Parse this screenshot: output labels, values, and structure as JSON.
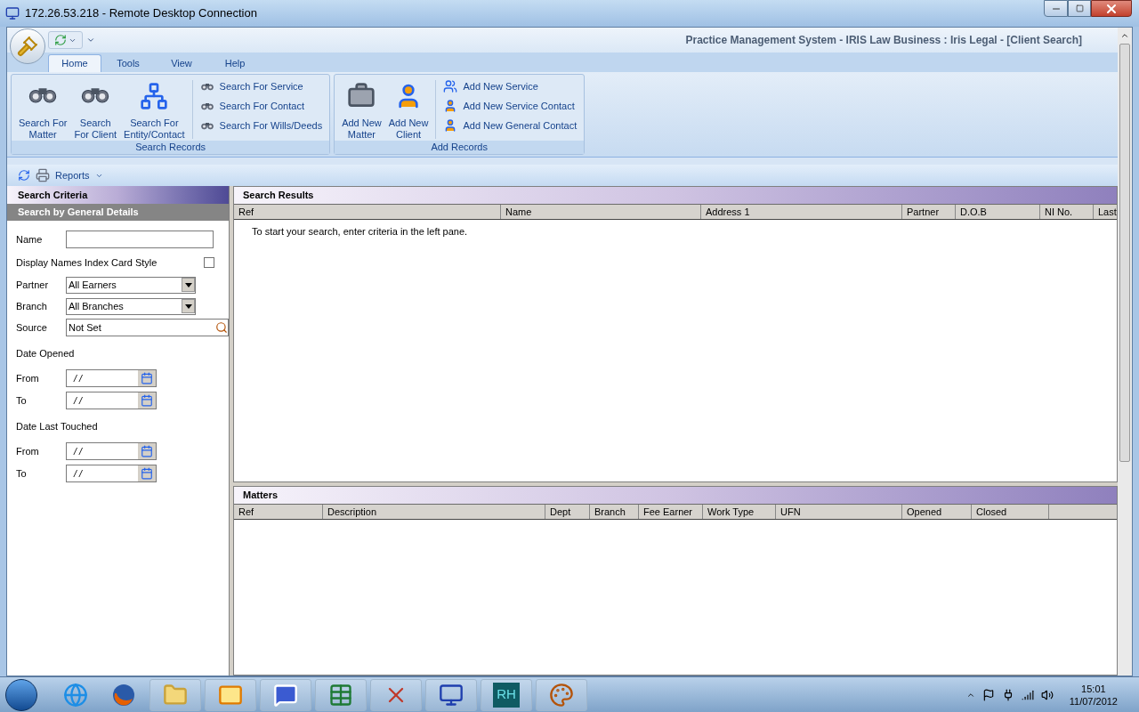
{
  "window": {
    "title": "172.26.53.218 - Remote Desktop Connection"
  },
  "app_title": "Practice Management System - IRIS Law Business : Iris Legal - [Client Search]",
  "ribbon": {
    "tabs": [
      {
        "label": "Home",
        "selected": true
      },
      {
        "label": "Tools",
        "selected": false
      },
      {
        "label": "View",
        "selected": false
      },
      {
        "label": "Help",
        "selected": false
      }
    ],
    "groups": [
      {
        "label": "Search Records",
        "large_buttons": [
          {
            "label": "Search For\nMatter",
            "kind": "binoculars"
          },
          {
            "label": "Search\nFor Client",
            "kind": "binoculars"
          },
          {
            "label": "Search For\nEntity/Contact",
            "kind": "network"
          }
        ],
        "small_buttons": [
          {
            "label": "Search For Service",
            "kind": "binoculars"
          },
          {
            "label": "Search For Contact",
            "kind": "binoculars"
          },
          {
            "label": "Search For Wills/Deeds",
            "kind": "binoculars"
          }
        ]
      },
      {
        "label": "Add Records",
        "large_buttons": [
          {
            "label": "Add New\nMatter",
            "kind": "briefcase"
          },
          {
            "label": "Add New\nClient",
            "kind": "person"
          }
        ],
        "small_buttons": [
          {
            "label": "Add New Service",
            "kind": "people"
          },
          {
            "label": "Add New Service Contact",
            "kind": "person"
          },
          {
            "label": "Add New General Contact",
            "kind": "person"
          }
        ]
      }
    ]
  },
  "toolbar": {
    "reports": "Reports"
  },
  "criteria": {
    "title": "Search Criteria",
    "subtitle": "Search by General Details",
    "fields": [
      {
        "kind": "text",
        "label": "Name"
      },
      {
        "kind": "checkbox",
        "label": "Display Names Index Card Style",
        "checked": false
      },
      {
        "kind": "select",
        "label": "Partner",
        "value": "All Earners"
      },
      {
        "kind": "select",
        "label": "Branch",
        "value": "All Branches"
      },
      {
        "kind": "lookup",
        "label": "Source",
        "value": "Not Set"
      },
      {
        "kind": "heading",
        "label": "Date Opened"
      },
      {
        "kind": "date",
        "label": "From",
        "value": "/ /"
      },
      {
        "kind": "date",
        "label": "To",
        "value": "/ /"
      },
      {
        "kind": "heading",
        "label": "Date Last Touched"
      },
      {
        "kind": "date",
        "label": "From",
        "value": "/ /"
      },
      {
        "kind": "date",
        "label": "To",
        "value": "/ /"
      }
    ]
  },
  "results": {
    "title": "Search Results",
    "columns": [
      "Ref",
      "Name",
      "Address 1",
      "Partner",
      "D.O.B",
      "NI No.",
      "Last"
    ],
    "message": "To start your search, enter criteria in the left pane."
  },
  "matters": {
    "title": "Matters",
    "columns": [
      "Ref",
      "Description",
      "Dept",
      "Branch",
      "Fee Earner",
      "Work Type",
      "UFN",
      "Opened",
      "Closed"
    ]
  },
  "taskbar": {
    "apps": [
      {
        "kind": "ie"
      },
      {
        "kind": "firefox"
      },
      {
        "kind": "explorer"
      },
      {
        "kind": "outlook"
      },
      {
        "kind": "remote"
      },
      {
        "kind": "excel"
      },
      {
        "kind": "xming"
      },
      {
        "kind": "rdc"
      },
      {
        "kind": "text",
        "text": "RH"
      },
      {
        "kind": "paint"
      }
    ],
    "time": "15:01",
    "date": "11/07/2012"
  }
}
